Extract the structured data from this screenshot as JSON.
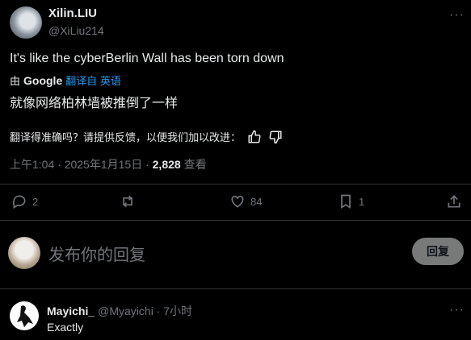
{
  "tweet": {
    "author_name": "Xilin.LIU",
    "author_handle": "@XiLiu214",
    "more_label": "···",
    "text": "It's like the cyberBerlin Wall has been torn down",
    "translation": {
      "by_prefix": "由",
      "provider": "Google",
      "link_label": "翻译自 英语",
      "text": "就像网络柏林墙被推倒了一样"
    },
    "feedback_prompt": "翻译得准确吗？请提供反馈，以便我们加以改进：",
    "timestamp": "上午1:04 · 2025年1月15日 · ",
    "views_count": "2,828",
    "views_label": " 查看"
  },
  "actions": {
    "replies": "2",
    "retweets": "",
    "likes": "84",
    "bookmarks": "1"
  },
  "composer": {
    "placeholder": "发布你的回复",
    "reply_button": "回复"
  },
  "comment": {
    "author_name": "Mayichi_",
    "meta": "@Myayichi · 7小时",
    "more_label": "···",
    "text": "Exactly"
  }
}
